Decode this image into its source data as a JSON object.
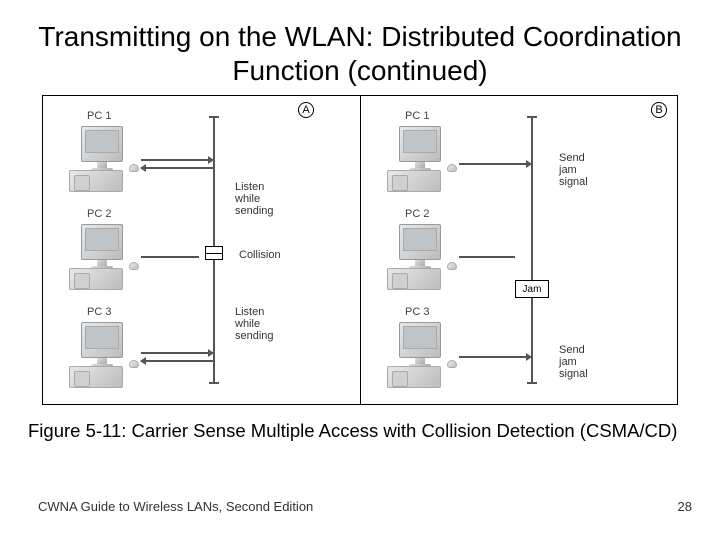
{
  "title": "Transmitting on the WLAN: Distributed Coordination Function (continued)",
  "caption": "Figure 5-11: Carrier Sense Multiple Access with Collision Detection (CSMA/CD)",
  "footer": {
    "left": "CWNA Guide to Wireless LANs, Second Edition",
    "page": "28"
  },
  "panels": {
    "a": {
      "label": "A",
      "pcs": [
        "PC 1",
        "PC 2",
        "PC 3"
      ],
      "notes": {
        "listen": "Listen\nwhile\nsending",
        "collision": "Collision"
      }
    },
    "b": {
      "label": "B",
      "pcs": [
        "PC 1",
        "PC 2",
        "PC 3"
      ],
      "notes": {
        "sendjam": "Send\njam\nsignal",
        "jam": "Jam"
      }
    }
  }
}
